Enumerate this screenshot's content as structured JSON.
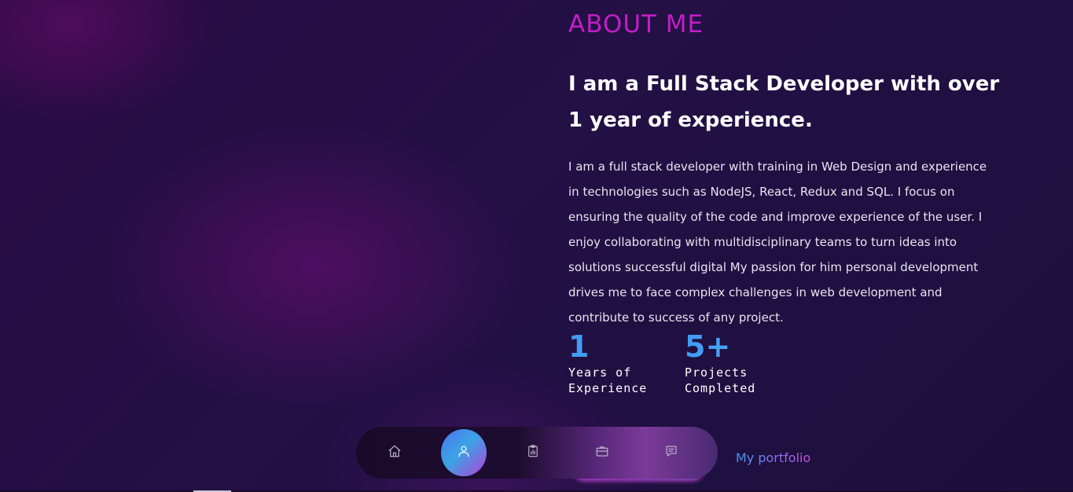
{
  "about": {
    "heading": "ABOUT ME",
    "title": "I am a Full Stack Developer with over 1 year of experience.",
    "description": "I am a full stack developer with training in Web Design and experience in technologies such as NodeJS, React, Redux and SQL. I focus on ensuring the quality of the code and improve experience of the user. I enjoy collaborating with multidisciplinary teams to turn ideas into solutions successful digital My passion for him personal development drives me to face complex challenges in web development and contribute to success of any project."
  },
  "stats": [
    {
      "number": "1",
      "label": "Years of Experience"
    },
    {
      "number": "5+",
      "label": "Projects Completed"
    }
  ],
  "nav": {
    "items": [
      {
        "icon": "home-icon",
        "active": false
      },
      {
        "icon": "user-icon",
        "active": true
      },
      {
        "icon": "clipboard-chart-icon",
        "active": false
      },
      {
        "icon": "briefcase-icon",
        "active": false
      },
      {
        "icon": "message-icon",
        "active": false
      }
    ]
  },
  "brand": {
    "label": "My portfolio"
  },
  "colors": {
    "heading_accent": "#c11ec6",
    "stat_gradient_start": "#3e9bf4",
    "stat_gradient_end": "#9b6cf0",
    "active_nav_start": "#4f72f0",
    "active_nav_end": "#b43fd8",
    "background": "#231045"
  }
}
